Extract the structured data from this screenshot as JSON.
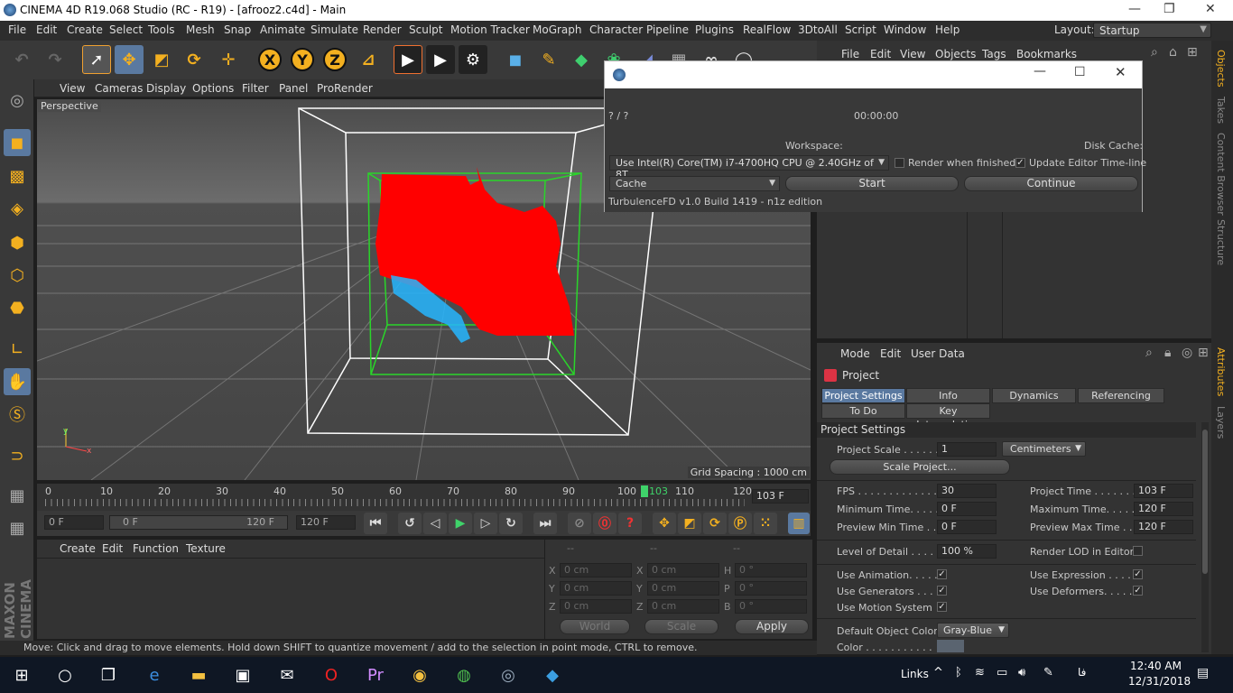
{
  "window": {
    "title": "CINEMA 4D R19.068 Studio (RC - R19) - [afrooz2.c4d] - Main"
  },
  "menu": [
    "File",
    "Edit",
    "Create",
    "Select",
    "Tools",
    "Mesh",
    "Snap",
    "Animate",
    "Simulate",
    "Render",
    "Sculpt",
    "Motion Tracker",
    "MoGraph",
    "Character",
    "Pipeline",
    "Plugins",
    "RealFlow",
    "3DtoAll",
    "Script",
    "Window",
    "Help"
  ],
  "layout": {
    "label": "Layout:",
    "value": "Startup"
  },
  "toolbar": {
    "x": "X",
    "y": "Y",
    "z": "Z"
  },
  "viewport": {
    "menu": [
      "View",
      "Cameras",
      "Display",
      "Options",
      "Filter",
      "Panel",
      "ProRender"
    ],
    "camera": "Perspective",
    "grid_spacing": "Grid Spacing : 1000 cm"
  },
  "timeline": {
    "ticks": [
      "0",
      "10",
      "20",
      "30",
      "40",
      "50",
      "60",
      "70",
      "80",
      "90",
      "100",
      "103",
      "110",
      "120"
    ],
    "current_frame": "103 F",
    "playhead": 103
  },
  "transport": {
    "start": "0 F",
    "range_start": "0 F",
    "range_end": "120 F",
    "end": "120 F"
  },
  "material": {
    "menu": [
      "Create",
      "Edit",
      "Function",
      "Texture"
    ]
  },
  "coords": {
    "headers": [
      "--",
      "--",
      "--"
    ],
    "rows": [
      [
        "X",
        "0 cm",
        "X",
        "0 cm",
        "H",
        "0 °"
      ],
      [
        "Y",
        "0 cm",
        "Y",
        "0 cm",
        "P",
        "0 °"
      ],
      [
        "Z",
        "0 cm",
        "Z",
        "0 cm",
        "B",
        "0 °"
      ]
    ],
    "world": "World",
    "scale": "Scale",
    "apply": "Apply"
  },
  "objects": {
    "menu": [
      "File",
      "Edit",
      "View",
      "Objects",
      "Tags",
      "Bookmarks"
    ]
  },
  "attributes": {
    "menu": [
      "Mode",
      "Edit",
      "User Data"
    ],
    "object": "Project",
    "tabs": [
      "Project Settings",
      "Info",
      "Dynamics",
      "Referencing"
    ],
    "tabs2": [
      "To Do",
      "Key Interpolation"
    ],
    "section": "Project Settings",
    "project_scale_label": "Project Scale . . . . . .",
    "project_scale": "1",
    "units": "Centimeters",
    "scale_project": "Scale Project...",
    "fps_label": "FPS . . . . . . . . . . . . . . .",
    "fps": "30",
    "project_time_label": "Project Time . . . . . . . .",
    "project_time": "103 F",
    "min_time_label": "Minimum Time. . . . .",
    "min_time": "0 F",
    "max_time_label": "Maximum Time. . . . . .",
    "max_time": "120 F",
    "prev_min_label": "Preview Min Time . .",
    "prev_min": "0 F",
    "prev_max_label": "Preview Max Time . . .",
    "prev_max": "120 F",
    "lod_label": "Level of Detail . . . . .",
    "lod": "100 %",
    "render_lod_label": "Render LOD in Editor",
    "use_animation": "Use Animation. . . . .",
    "use_expression": "Use Expression . . . . .",
    "use_generators": "Use Generators . . . .",
    "use_deformers": "Use Deformers. . . . . .",
    "use_motion": "Use Motion System",
    "default_color_label": "Default Object Color",
    "default_color": "Gray-Blue",
    "color_label": "Color . . . . . . . . . . ."
  },
  "right_tabs": [
    "Objects",
    "Takes",
    "Content Browser",
    "Structure",
    "Attributes",
    "Layers"
  ],
  "dialog": {
    "progress": "? / ?",
    "time": "00:00:00",
    "workspace_label": "Workspace:",
    "disk_cache_label": "Disk Cache:",
    "cpu": "Use  Intel(R) Core(TM) i7-4700HQ CPU @ 2.40GHz  of 8T",
    "render_when_finished": "Render when finished",
    "update_editor": "Update Editor Time-line",
    "cache": "Cache",
    "start": "Start",
    "continue": "Continue",
    "footer": "TurbulenceFD v1.0 Build 1419 - n1z edition"
  },
  "status": "Move: Click and drag to move elements. Hold down SHIFT to quantize movement / add to the selection in point mode, CTRL to remove.",
  "branding": "MAXON CINEMA 4D",
  "taskbar": {
    "links": "Links",
    "lang": "فا",
    "time": "12:40 AM",
    "date": "12/31/2018"
  }
}
